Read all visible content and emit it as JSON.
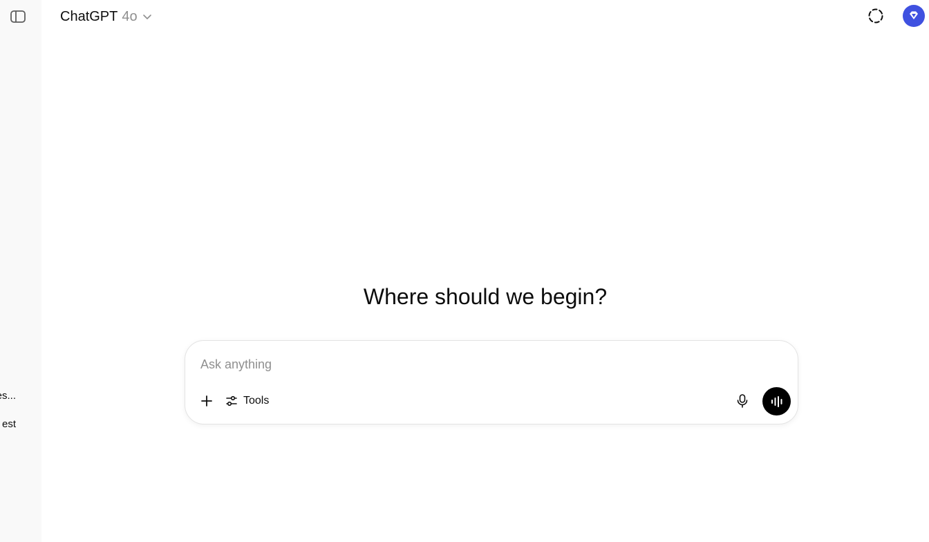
{
  "header": {
    "model_name": "ChatGPT",
    "model_version": "4o"
  },
  "sidebar": {
    "snippets": [
      "es...",
      "est"
    ]
  },
  "main": {
    "headline": "Where should we begin?"
  },
  "composer": {
    "placeholder": "Ask anything",
    "value": "",
    "tools_label": "Tools"
  },
  "icons": {
    "sidebar_toggle": "sidebar-toggle-icon",
    "model_chevron": "chevron-down-icon",
    "temporary_chat": "dashed-circle-icon",
    "avatar": "diamond-icon",
    "add": "plus-icon",
    "tools": "sliders-icon",
    "mic": "microphone-icon",
    "voice": "waveform-icon"
  },
  "colors": {
    "avatar_bg": "#3f51e0",
    "voice_button_bg": "#000000",
    "sidebar_bg": "#f9f9f9",
    "muted_text": "#8f8f8f"
  }
}
